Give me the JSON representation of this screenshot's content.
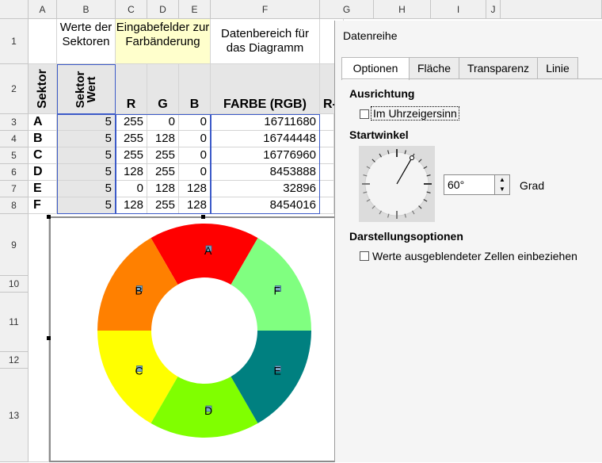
{
  "columns": [
    "A",
    "B",
    "C",
    "D",
    "E",
    "F",
    "G",
    "H",
    "I",
    "J"
  ],
  "rows": [
    "1",
    "2",
    "3",
    "4",
    "5",
    "6",
    "7",
    "8",
    "9",
    "10",
    "11",
    "12",
    "13"
  ],
  "headers": {
    "b1": "Werte der Sektoren",
    "cde1": "Eingabefelder zur Farbänderung",
    "f1": "Datenbereich für das Diagramm",
    "a2": "Sektor",
    "b2": "Sektor Wert",
    "c2": "R",
    "d2": "G",
    "e2": "B",
    "f2": "FARBE (RGB)",
    "g2": "R-"
  },
  "table": [
    {
      "sektor": "A",
      "wert": "5",
      "r": "255",
      "g": "0",
      "b": "0",
      "rgb": "16711680"
    },
    {
      "sektor": "B",
      "wert": "5",
      "r": "255",
      "g": "128",
      "b": "0",
      "rgb": "16744448"
    },
    {
      "sektor": "C",
      "wert": "5",
      "r": "255",
      "g": "255",
      "b": "0",
      "rgb": "16776960"
    },
    {
      "sektor": "D",
      "wert": "5",
      "r": "128",
      "g": "255",
      "b": "0",
      "rgb": "8453888"
    },
    {
      "sektor": "E",
      "wert": "5",
      "r": "0",
      "g": "128",
      "b": "128",
      "rgb": "32896"
    },
    {
      "sektor": "F",
      "wert": "5",
      "r": "128",
      "g": "255",
      "b": "128",
      "rgb": "8454016"
    }
  ],
  "chart_data": {
    "type": "pie",
    "donut": true,
    "start_angle_deg": 60,
    "clockwise": false,
    "categories": [
      "A",
      "B",
      "C",
      "D",
      "E",
      "F"
    ],
    "values": [
      5,
      5,
      5,
      5,
      5,
      5
    ],
    "colors": [
      "#ff0000",
      "#ff8000",
      "#ffff00",
      "#80ff00",
      "#008080",
      "#80ff80"
    ]
  },
  "dialog": {
    "title": "Datenreihe",
    "tabs": [
      "Optionen",
      "Fläche",
      "Transparenz",
      "Linie"
    ],
    "ausrichtung_label": "Ausrichtung",
    "clockwise_label": "Im Uhrzeigersinn",
    "startwinkel_label": "Startwinkel",
    "angle_value": "60°",
    "grad_label": "Grad",
    "darstellung_label": "Darstellungsoptionen",
    "hidden_cells_label": "Werte ausgeblendeter Zellen einbeziehen"
  }
}
